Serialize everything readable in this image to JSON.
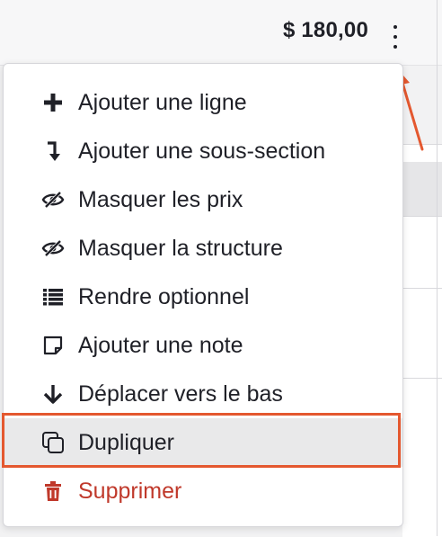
{
  "header": {
    "total": "$ 180,00",
    "more_icon": "vertical-ellipsis-icon"
  },
  "menu": {
    "items": [
      {
        "label": "Ajouter une ligne",
        "icon": "plus-icon"
      },
      {
        "label": "Ajouter une sous-section",
        "icon": "arrow-turn-down-icon"
      },
      {
        "label": "Masquer les prix",
        "icon": "eye-slash-icon"
      },
      {
        "label": "Masquer la structure",
        "icon": "eye-slash-icon"
      },
      {
        "label": "Rendre optionnel",
        "icon": "list-icon"
      },
      {
        "label": "Ajouter une note",
        "icon": "sticky-note-icon"
      },
      {
        "label": "Déplacer vers le bas",
        "icon": "arrow-down-icon"
      },
      {
        "label": "Dupliquer",
        "icon": "copy-icon",
        "highlighted": true
      },
      {
        "label": "Supprimer",
        "icon": "trash-icon",
        "danger": true
      }
    ]
  },
  "colors": {
    "text": "#1f2027",
    "danger": "#c0392b",
    "highlight_border": "#e4582f",
    "annotation_arrow": "#e4582f",
    "hover_background": "#e9e9ea"
  }
}
